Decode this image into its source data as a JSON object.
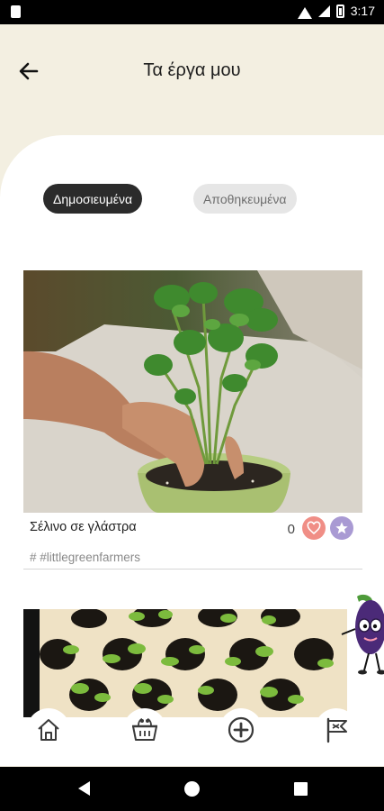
{
  "status_bar": {
    "time": "3:17",
    "icons": [
      "sim-icon",
      "wifi-icon",
      "signal-icon",
      "battery-icon"
    ]
  },
  "header": {
    "title": "Τα έργα μου",
    "back_icon": "arrow-left-icon"
  },
  "tabs": [
    {
      "label": "Δημοσιευμένα",
      "active": true
    },
    {
      "label": "Αποθηκευμένα",
      "active": false
    }
  ],
  "posts": [
    {
      "title": "Σέλινο σε γλάστρα",
      "likes": "0",
      "tag": "# #littlegreenfarmers",
      "image": "celery-in-pot-photo"
    },
    {
      "image": "seedlings-egg-carton-photo"
    }
  ],
  "bottom_nav": [
    {
      "icon": "home-icon"
    },
    {
      "icon": "basket-icon"
    },
    {
      "icon": "add-circle-icon"
    },
    {
      "icon": "flag-icon"
    }
  ],
  "colors": {
    "background": "#f3efe1",
    "active_tab": "#2b2b2b",
    "heart": "#f08e86",
    "star": "#a99ad3"
  }
}
